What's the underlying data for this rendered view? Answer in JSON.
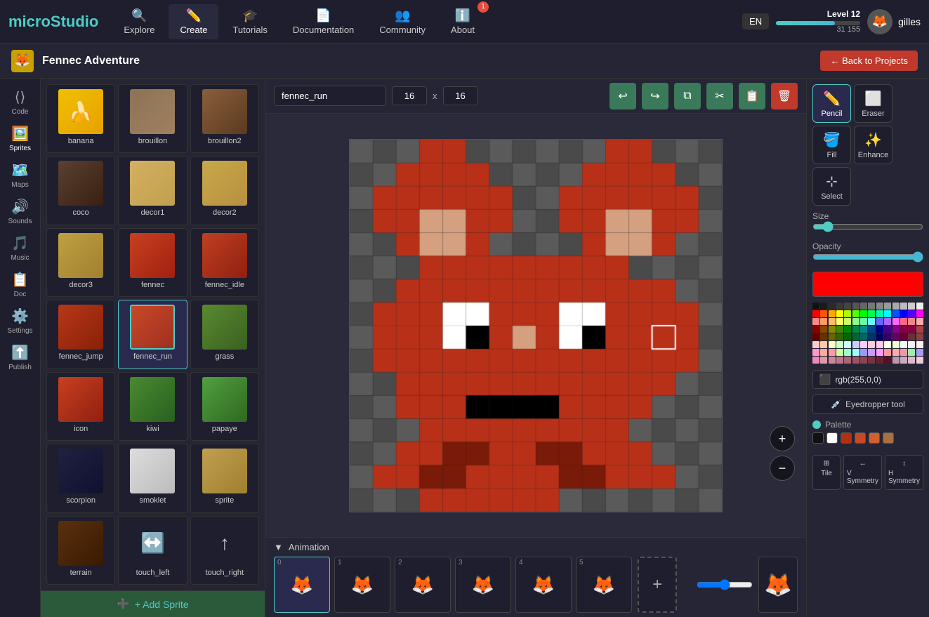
{
  "app": {
    "logo_micro": "micro",
    "logo_studio": "Studio"
  },
  "nav": {
    "items": [
      {
        "label": "Explore",
        "icon": "🔍"
      },
      {
        "label": "Create",
        "icon": "✏️",
        "active": true
      },
      {
        "label": "Tutorials",
        "icon": "🎓"
      },
      {
        "label": "Documentation",
        "icon": "📄"
      },
      {
        "label": "Community",
        "icon": "👥"
      },
      {
        "label": "About",
        "icon": "ℹ️",
        "badge": "1"
      }
    ],
    "lang": "EN",
    "level": "Level 12",
    "xp": "31 155",
    "username": "gilles"
  },
  "project": {
    "title": "Fennec Adventure",
    "back_label": "← Back to Projects"
  },
  "sidebar": {
    "items": [
      {
        "label": "Code",
        "icon": "⟨⟩"
      },
      {
        "label": "Sprites",
        "icon": "🖼️",
        "active": true
      },
      {
        "label": "Maps",
        "icon": "🗺️"
      },
      {
        "label": "Sounds",
        "icon": "🔊"
      },
      {
        "label": "Music",
        "icon": "🎵"
      },
      {
        "label": "Doc",
        "icon": "📋"
      },
      {
        "label": "Settings",
        "icon": "⚙️"
      },
      {
        "label": "Publish",
        "icon": "⬆️"
      }
    ]
  },
  "sprites": [
    {
      "name": "banana",
      "class": "sp-banana",
      "emoji": "🍌"
    },
    {
      "name": "brouillon",
      "class": "sp-brouillon",
      "emoji": ""
    },
    {
      "name": "brouillon2",
      "class": "sp-brouillon2",
      "emoji": ""
    },
    {
      "name": "coco",
      "class": "sp-coco",
      "emoji": ""
    },
    {
      "name": "decor1",
      "class": "sp-decor1",
      "emoji": ""
    },
    {
      "name": "decor2",
      "class": "sp-decor2",
      "emoji": ""
    },
    {
      "name": "decor3",
      "class": "sp-decor3",
      "emoji": ""
    },
    {
      "name": "fennec",
      "class": "sp-fennec",
      "emoji": ""
    },
    {
      "name": "fennec_idle",
      "class": "sp-fennec-idle",
      "emoji": ""
    },
    {
      "name": "fennec_jump",
      "class": "sp-fennec-jump",
      "emoji": ""
    },
    {
      "name": "fennec_run",
      "class": "sp-fennec-run",
      "emoji": "",
      "active": true
    },
    {
      "name": "grass",
      "class": "sp-grass",
      "emoji": ""
    },
    {
      "name": "icon",
      "class": "sp-icon",
      "emoji": ""
    },
    {
      "name": "kiwi",
      "class": "sp-kiwi",
      "emoji": ""
    },
    {
      "name": "papaye",
      "class": "sp-papaye",
      "emoji": ""
    },
    {
      "name": "scorpion",
      "class": "sp-scorpion",
      "emoji": ""
    },
    {
      "name": "smoklet",
      "class": "sp-smoklet",
      "emoji": ""
    },
    {
      "name": "sprite",
      "class": "sp-sprite",
      "emoji": ""
    },
    {
      "name": "terrain",
      "class": "sp-terrain",
      "emoji": ""
    },
    {
      "name": "touch_left",
      "class": "sp-touch-left",
      "emoji": "↔️"
    },
    {
      "name": "touch_right",
      "class": "sp-touch-right",
      "emoji": "↑"
    }
  ],
  "add_sprite_label": "+ Add Sprite",
  "canvas": {
    "sprite_name": "fennec_run",
    "width": "16",
    "height": "16"
  },
  "toolbar_buttons": [
    {
      "id": "undo",
      "icon": "↩",
      "label": "Undo"
    },
    {
      "id": "redo",
      "icon": "↪",
      "label": "Redo"
    },
    {
      "id": "copy",
      "icon": "⧉",
      "label": "Copy"
    },
    {
      "id": "cut",
      "icon": "✂",
      "label": "Cut"
    },
    {
      "id": "paste",
      "icon": "📋",
      "label": "Paste"
    },
    {
      "id": "delete",
      "icon": "🗑",
      "label": "Delete",
      "red": true
    }
  ],
  "tools": [
    {
      "id": "pencil",
      "icon": "✏️",
      "label": "Pencil",
      "active": true
    },
    {
      "id": "eraser",
      "icon": "◻",
      "label": "Eraser"
    },
    {
      "id": "fill",
      "icon": "🪣",
      "label": "Fill"
    },
    {
      "id": "enhance",
      "icon": "✨",
      "label": "Enhance"
    },
    {
      "id": "select",
      "icon": "⊹",
      "label": "Select"
    }
  ],
  "right_panel": {
    "size_label": "Size",
    "opacity_label": "Opacity",
    "color_value": "rgb(255,0,0)",
    "eyedropper_label": "Eyedropper tool",
    "palette_label": "Palette"
  },
  "animation": {
    "label": "Animation",
    "frames": [
      {
        "num": "0",
        "active": true
      },
      {
        "num": "1"
      },
      {
        "num": "2"
      },
      {
        "num": "3"
      },
      {
        "num": "4"
      },
      {
        "num": "5"
      }
    ]
  },
  "bottom_tools": [
    {
      "label": "Tile",
      "icon": "⊞"
    },
    {
      "label": "V Symmetry",
      "icon": "↔"
    },
    {
      "label": "H Symmetry",
      "icon": "↕"
    }
  ],
  "palette_colors": {
    "grays": [
      "#111",
      "#222",
      "#333",
      "#444",
      "#555",
      "#666",
      "#777",
      "#888",
      "#999",
      "#aaa",
      "#bbb",
      "#ccc",
      "#ddd",
      "#eee"
    ],
    "row1": [
      "#f00",
      "#f60",
      "#fc0",
      "#ff0",
      "#cf0",
      "#6f0",
      "#0f0",
      "#0f6",
      "#0fc",
      "#0ff",
      "#06f",
      "#00f",
      "#60f",
      "#f0f"
    ],
    "row2": [
      "#f88",
      "#fa8",
      "#fd8",
      "#ff8",
      "#df8",
      "#8f8",
      "#8fa",
      "#8fd",
      "#8ff",
      "#88f",
      "#a8f",
      "#f8f",
      "#f8a",
      "#f88"
    ],
    "saved": [
      "#111",
      "#fff",
      "#b03010",
      "#c84828",
      "#d06030",
      "#a87040"
    ]
  }
}
